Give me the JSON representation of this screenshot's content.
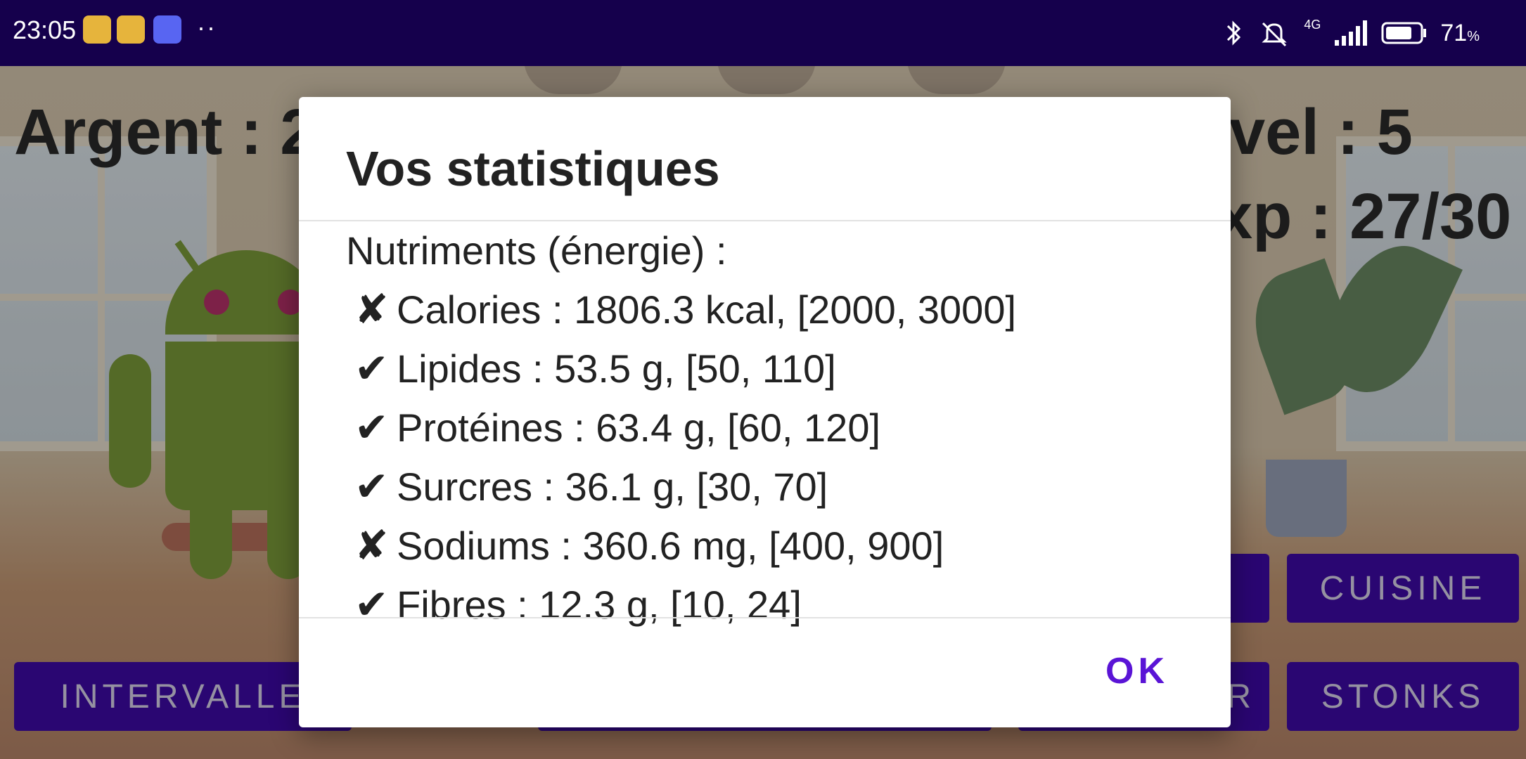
{
  "status_bar": {
    "time": "23:05",
    "overflow": "··",
    "battery_percent": "71",
    "battery_unit": "%",
    "network": "4G",
    "icons": [
      "bluetooth-icon",
      "silent-icon",
      "signal-icon",
      "battery-icon"
    ]
  },
  "hud": {
    "money": "Argent : 2",
    "level": "vel : 5",
    "exp": "xp : 27/30"
  },
  "buttons": {
    "cuisine": "CUISINE",
    "stonks": "STONKS",
    "intervalle": "INTERVALLE",
    "partial_r": "R"
  },
  "dialog": {
    "title": "Vos statistiques",
    "heading": "Nutriments (énergie) :",
    "stats": [
      {
        "mark": "✘",
        "text": "Calories : 1806.3 kcal, [2000, 3000]"
      },
      {
        "mark": "✔",
        "text": "Lipides : 53.5 g, [50, 110]"
      },
      {
        "mark": "✔",
        "text": "Protéines : 63.4 g, [60, 120]"
      },
      {
        "mark": "✔",
        "text": "Surcres : 36.1 g, [30, 70]"
      },
      {
        "mark": "✘",
        "text": "Sodiums : 360.6 mg, [400, 900]"
      },
      {
        "mark": "✔",
        "text": "Fibres : 12.3 g, [10, 24]"
      }
    ],
    "ok_label": "OK"
  },
  "colors": {
    "status_bar": "#15004c",
    "primary": "#3f0aa8",
    "accent": "#5a14d6"
  }
}
